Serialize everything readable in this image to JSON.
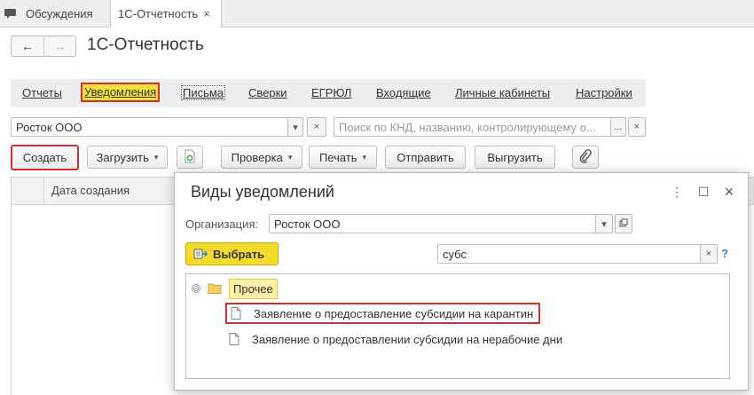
{
  "tabs": [
    {
      "label": "Обсуждения"
    },
    {
      "label": "1С-Отчетность",
      "close": "×"
    }
  ],
  "page": {
    "title": "1С-Отчетность",
    "nav_back": "←",
    "nav_forward": "→"
  },
  "menu": [
    {
      "label": "Отчеты"
    },
    {
      "label": "Уведомления"
    },
    {
      "label": "Письма"
    },
    {
      "label": "Сверки"
    },
    {
      "label": "ЕГРЮЛ"
    },
    {
      "label": "Входящие"
    },
    {
      "label": "Личные кабинеты"
    },
    {
      "label": "Настройки"
    }
  ],
  "org_field": {
    "value": "Росток ООО",
    "dropdown": "▾",
    "clear": "×"
  },
  "search": {
    "placeholder": "Поиск по КНД, названию, контролирующему о...",
    "more": "...",
    "clear": "×"
  },
  "toolbar": {
    "create": "Создать",
    "upload": "Загрузить",
    "check": "Проверка",
    "print": "Печать",
    "send": "Отправить",
    "export": "Выгрузить",
    "caret": "▾"
  },
  "table": {
    "columns": [
      "Дата создания"
    ]
  },
  "dialog": {
    "title": "Виды уведомлений",
    "menu_icon": "⋮",
    "maximize_icon": "☐",
    "close_icon": "×",
    "org_label": "Организация:",
    "org_value": "Росток ООО",
    "select_button": "Выбрать",
    "search_value": "субс",
    "search_clear": "×",
    "help": "?",
    "tree": {
      "folder": "Прочее",
      "collapse": "⊖",
      "items": [
        {
          "label": "Заявление о предоставление субсидии на карантин"
        },
        {
          "label": "Заявление о предоставлении субсидии на нерабочие дни"
        }
      ]
    }
  },
  "colors": {
    "accent_yellow": "#f5dc2c",
    "highlight_red": "#d32f2f",
    "link_blue": "#2a7fd4"
  },
  "icons": [
    "chat-icon",
    "arrow-left-icon",
    "arrow-right-icon",
    "add-file-icon",
    "paperclip-icon",
    "select-icon",
    "folder-icon",
    "document-icon"
  ]
}
